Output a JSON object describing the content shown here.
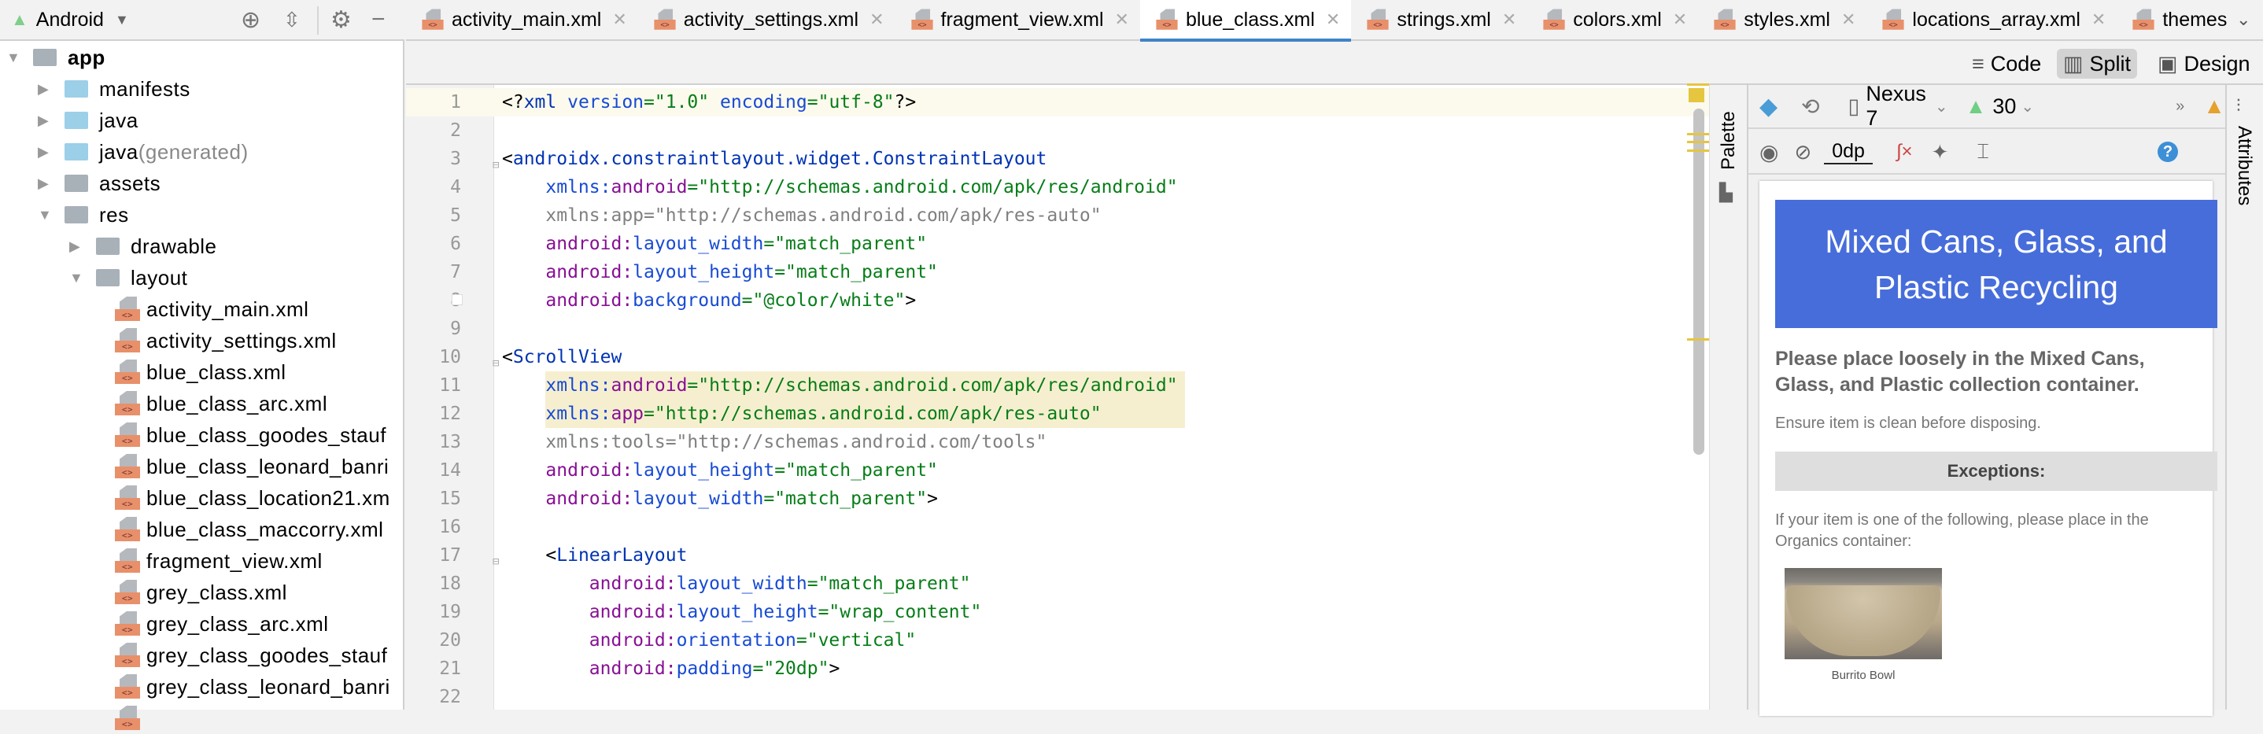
{
  "sidebar": {
    "view_label": "Android",
    "tree": [
      {
        "label": "app",
        "level": 0,
        "icon": "app-module-icon",
        "arrow": "down",
        "bold": true
      },
      {
        "label": "manifests",
        "level": 1,
        "icon": "folder-icon",
        "arrow": "right"
      },
      {
        "label": "java",
        "level": 1,
        "icon": "folder-icon",
        "arrow": "right"
      },
      {
        "label": "java",
        "suffix": " (generated)",
        "level": 1,
        "icon": "generated-folder-icon",
        "arrow": "right"
      },
      {
        "label": "assets",
        "level": 1,
        "icon": "assets-folder-icon",
        "arrow": "right"
      },
      {
        "label": "res",
        "level": 1,
        "icon": "res-folder-icon",
        "arrow": "down"
      },
      {
        "label": "drawable",
        "level": 2,
        "icon": "folder-icon",
        "arrow": "right"
      },
      {
        "label": "layout",
        "level": 2,
        "icon": "folder-icon",
        "arrow": "down"
      },
      {
        "label": "activity_main.xml",
        "level": 3,
        "icon": "xml-file-icon"
      },
      {
        "label": "activity_settings.xml",
        "level": 3,
        "icon": "xml-file-icon"
      },
      {
        "label": "blue_class.xml",
        "level": 3,
        "icon": "xml-file-icon"
      },
      {
        "label": "blue_class_arc.xml",
        "level": 3,
        "icon": "xml-file-icon"
      },
      {
        "label": "blue_class_goodes_stauf",
        "level": 3,
        "icon": "xml-file-icon"
      },
      {
        "label": "blue_class_leonard_banri",
        "level": 3,
        "icon": "xml-file-icon"
      },
      {
        "label": "blue_class_location21.xm",
        "level": 3,
        "icon": "xml-file-icon"
      },
      {
        "label": "blue_class_maccorry.xml",
        "level": 3,
        "icon": "xml-file-icon"
      },
      {
        "label": "fragment_view.xml",
        "level": 3,
        "icon": "xml-file-icon"
      },
      {
        "label": "grey_class.xml",
        "level": 3,
        "icon": "xml-file-icon"
      },
      {
        "label": "grey_class_arc.xml",
        "level": 3,
        "icon": "xml-file-icon"
      },
      {
        "label": "grey_class_goodes_stauf",
        "level": 3,
        "icon": "xml-file-icon"
      },
      {
        "label": "grey_class_leonard_banri",
        "level": 3,
        "icon": "xml-file-icon"
      },
      {
        "label": "",
        "level": 3,
        "icon": "xml-file-icon"
      }
    ]
  },
  "tabs": [
    {
      "label": "activity_main.xml"
    },
    {
      "label": "activity_settings.xml"
    },
    {
      "label": "fragment_view.xml"
    },
    {
      "label": "blue_class.xml",
      "active": true
    },
    {
      "label": "strings.xml"
    },
    {
      "label": "colors.xml"
    },
    {
      "label": "styles.xml"
    },
    {
      "label": "locations_array.xml"
    },
    {
      "label": "themes",
      "noclose": true
    }
  ],
  "view_modes": {
    "code": "Code",
    "split": "Split",
    "design": "Design",
    "selected": "Split"
  },
  "code": {
    "highlight_lines": [
      11,
      12
    ],
    "current_line": 1,
    "lines": [
      [
        [
          "<?",
          "p"
        ],
        [
          "xml ",
          "tag"
        ],
        [
          "version",
          "attr"
        ],
        [
          "=\"1.0\" ",
          "val"
        ],
        [
          "encoding",
          "attr"
        ],
        [
          "=\"utf-8\"",
          "val"
        ],
        [
          "?>",
          "p"
        ]
      ],
      [],
      [
        [
          "<",
          "p"
        ],
        [
          "androidx.constraintlayout.widget.ConstraintLayout",
          "tag"
        ]
      ],
      [
        [
          "    xmlns:",
          "attr"
        ],
        [
          "android",
          "ns"
        ],
        [
          "=\"http://schemas.android.com/apk/res/android\"",
          "val"
        ]
      ],
      [
        [
          "    xmlns:app=\"http://schemas.android.com/apk/res-auto\"",
          "gray"
        ]
      ],
      [
        [
          "    android:",
          "ns"
        ],
        [
          "layout_width",
          "attr"
        ],
        [
          "=\"match_parent\"",
          "val"
        ]
      ],
      [
        [
          "    android:",
          "ns"
        ],
        [
          "layout_height",
          "attr"
        ],
        [
          "=\"match_parent\"",
          "val"
        ]
      ],
      [
        [
          "    android:",
          "ns"
        ],
        [
          "background",
          "attr"
        ],
        [
          "=\"@color/white\"",
          "val"
        ],
        [
          ">",
          "p"
        ]
      ],
      [],
      [
        [
          "<",
          "p"
        ],
        [
          "ScrollView",
          "tag"
        ]
      ],
      [
        [
          "    xmlns:",
          "attr"
        ],
        [
          "android",
          "ns"
        ],
        [
          "=\"http://schemas.android.com/apk/res/android\"",
          "val"
        ]
      ],
      [
        [
          "    xmlns:",
          "attr"
        ],
        [
          "app",
          "ns"
        ],
        [
          "=\"http://schemas.android.com/apk/res-auto\"",
          "val"
        ]
      ],
      [
        [
          "    xmlns:tools=\"http://schemas.android.com/tools\"",
          "gray"
        ]
      ],
      [
        [
          "    android:",
          "ns"
        ],
        [
          "layout_height",
          "attr"
        ],
        [
          "=\"match_parent\"",
          "val"
        ]
      ],
      [
        [
          "    android:",
          "ns"
        ],
        [
          "layout_width",
          "attr"
        ],
        [
          "=\"match_parent\"",
          "val"
        ],
        [
          ">",
          "p"
        ]
      ],
      [],
      [
        [
          "    <",
          "p"
        ],
        [
          "LinearLayout",
          "tag"
        ]
      ],
      [
        [
          "        android:",
          "ns"
        ],
        [
          "layout_width",
          "attr"
        ],
        [
          "=\"match_parent\"",
          "val"
        ]
      ],
      [
        [
          "        android:",
          "ns"
        ],
        [
          "layout_height",
          "attr"
        ],
        [
          "=\"wrap_content\"",
          "val"
        ]
      ],
      [
        [
          "        android:",
          "ns"
        ],
        [
          "orientation",
          "attr"
        ],
        [
          "=\"vertical\"",
          "val"
        ]
      ],
      [
        [
          "        android:",
          "ns"
        ],
        [
          "padding",
          "attr"
        ],
        [
          "=\"20dp\"",
          "val"
        ],
        [
          ">",
          "p"
        ]
      ],
      []
    ]
  },
  "palette_label": "Palette",
  "attributes_label": "Attributes",
  "design_toolbar": {
    "device": "Nexus 7",
    "api": "30",
    "margin": "0dp"
  },
  "preview": {
    "header": "Mixed Cans, Glass, and Plastic Recycling",
    "header_color": "#476ddb",
    "instruction": "Please place loosely in the Mixed Cans, Glass, and Plastic collection container.",
    "note": "Ensure item is clean before disposing.",
    "exceptions_title": "Exceptions:",
    "exceptions_text": "If your item is one of the following, please place in the Organics container:",
    "image_caption": "Burrito Bowl"
  },
  "colors": {
    "active_tab": "#4083c9",
    "marker": "#e6c53f",
    "warning": "#e6a02c",
    "help": "#3d8fd6"
  }
}
